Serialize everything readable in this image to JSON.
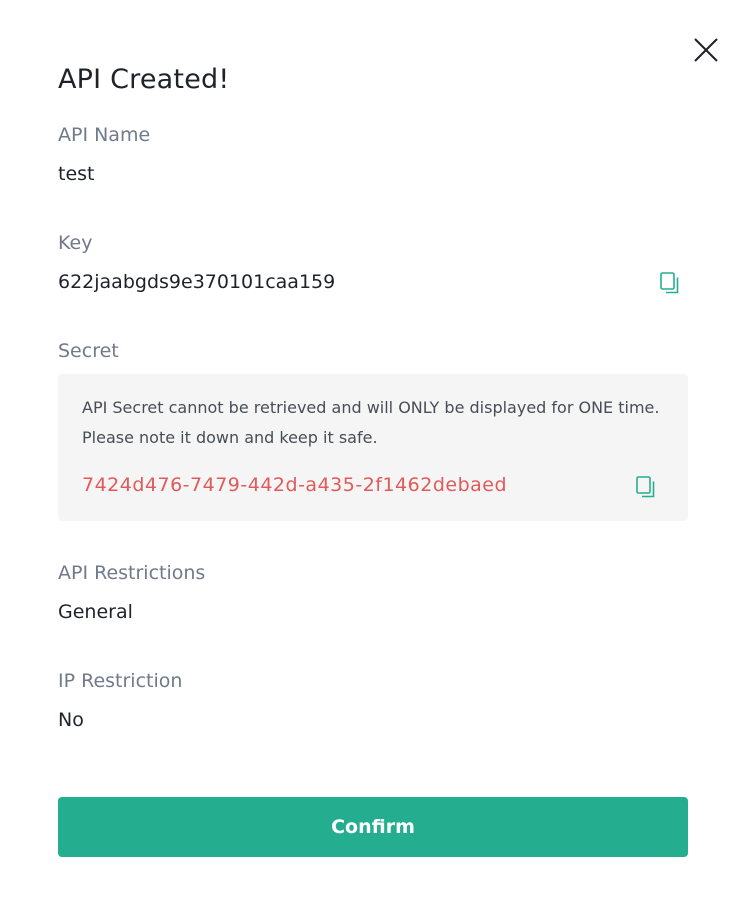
{
  "dialog": {
    "title": "API Created!",
    "api_name_label": "API Name",
    "api_name_value": "test",
    "key_label": "Key",
    "key_value": "622jaabgds9e370101caa159",
    "secret_label": "Secret",
    "secret_note_line1": "API Secret cannot be retrieved and will ONLY be displayed for ONE time.",
    "secret_note_line2": "Please note it down and keep it safe.",
    "secret_value": "7424d476-7479-442d-a435-2f1462debaed",
    "restrictions_label": "API Restrictions",
    "restrictions_value": "General",
    "ip_label": "IP Restriction",
    "ip_value": "No",
    "confirm_label": "Confirm"
  },
  "icons": {
    "close": "close-icon",
    "copy": "copy-icon"
  },
  "colors": {
    "accent": "#24ae8f",
    "secret_text": "#e05a5a",
    "label_text": "#707a8a",
    "value_text": "#1e2329",
    "secret_bg": "#f5f5f5"
  }
}
